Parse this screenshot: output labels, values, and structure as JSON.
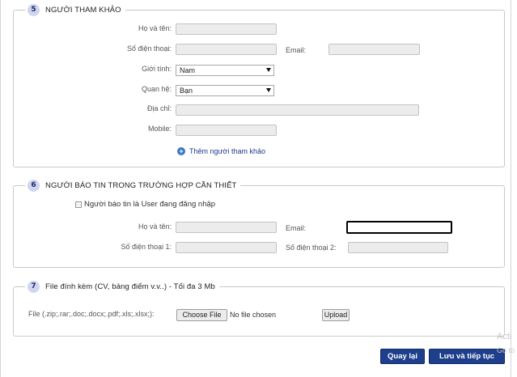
{
  "section5": {
    "number": "5",
    "title": "NGƯỜI THAM KHẢO",
    "name_label": "Họ và tên:",
    "phone_label": "Số điện thoại:",
    "email_label": "Email:",
    "gender_label": "Giới tính:",
    "gender_value": "Nam",
    "relation_label": "Quan hệ:",
    "relation_value": "Bạn",
    "address_label": "Địa chỉ:",
    "mobile_label": "Mobile:",
    "add_link": "Thêm người tham khảo"
  },
  "section6": {
    "number": "6",
    "title": "NGƯỜI BÁO TIN TRONG TRƯỜNG HỢP CẦN THIẾT",
    "checkbox_label": "Người báo tin là User đang đăng nhập",
    "checkbox_checked": false,
    "name_label": "Họ và tên:",
    "email_label": "Email:",
    "phone1_label": "Số điện thoại 1:",
    "phone2_label": "Số điện thoại 2:"
  },
  "section7": {
    "number": "7",
    "title": "File đính kèm (CV, bảng điểm v.v..) - Tối đa 3 Mb",
    "file_label": "File (.zip;.rar;.doc;.docx;.pdf;.xls;.xlsx;):",
    "choose_button": "Choose File",
    "file_status": "No file chosen",
    "upload_button": "Upload"
  },
  "actions": {
    "back_button": "Quay lại",
    "save_button": "Lưu và tiếp tục"
  },
  "watermark": {
    "line1": "Acti",
    "line2": "Go to"
  }
}
